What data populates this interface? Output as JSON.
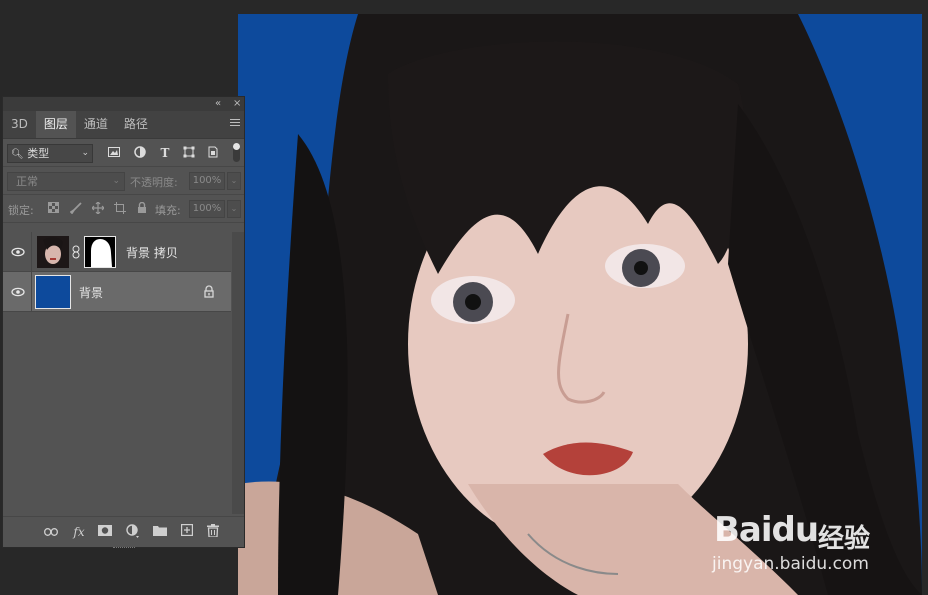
{
  "panel": {
    "collapse_icon": "double-chevron-left-icon",
    "close_icon": "close-icon",
    "tabs": [
      {
        "label": "3D",
        "active": false
      },
      {
        "label": "图层",
        "active": true
      },
      {
        "label": "通道",
        "active": false
      },
      {
        "label": "路径",
        "active": false
      }
    ],
    "filter": {
      "kind_label": "类型",
      "icons": [
        "image-filter-icon",
        "adjustment-filter-icon",
        "type-filter-icon",
        "shape-filter-icon",
        "smart-object-filter-icon"
      ]
    },
    "blend": {
      "mode": "正常",
      "opacity_label": "不透明度:",
      "opacity_value": "100%"
    },
    "lock": {
      "label": "锁定:",
      "fill_label": "填充:",
      "fill_value": "100%"
    },
    "layers": [
      {
        "name": "背景 拷贝",
        "visible": true,
        "selected": false,
        "has_mask": true,
        "locked": false
      },
      {
        "name": "背景",
        "visible": true,
        "selected": true,
        "has_mask": false,
        "locked": true,
        "fill_color": "#0d4a9c"
      }
    ],
    "footer_icons": [
      "link-layers-icon",
      "fx-icon",
      "add-mask-icon",
      "adjustment-layer-icon",
      "new-group-icon",
      "new-layer-icon",
      "delete-icon"
    ],
    "fx_label": "fx"
  },
  "canvas": {
    "background_color": "#0d4a9c"
  },
  "watermark": {
    "logo_text_1": "Bai",
    "logo_text_2": "du",
    "brand": "经验",
    "url": "jingyan.baidu.com"
  }
}
